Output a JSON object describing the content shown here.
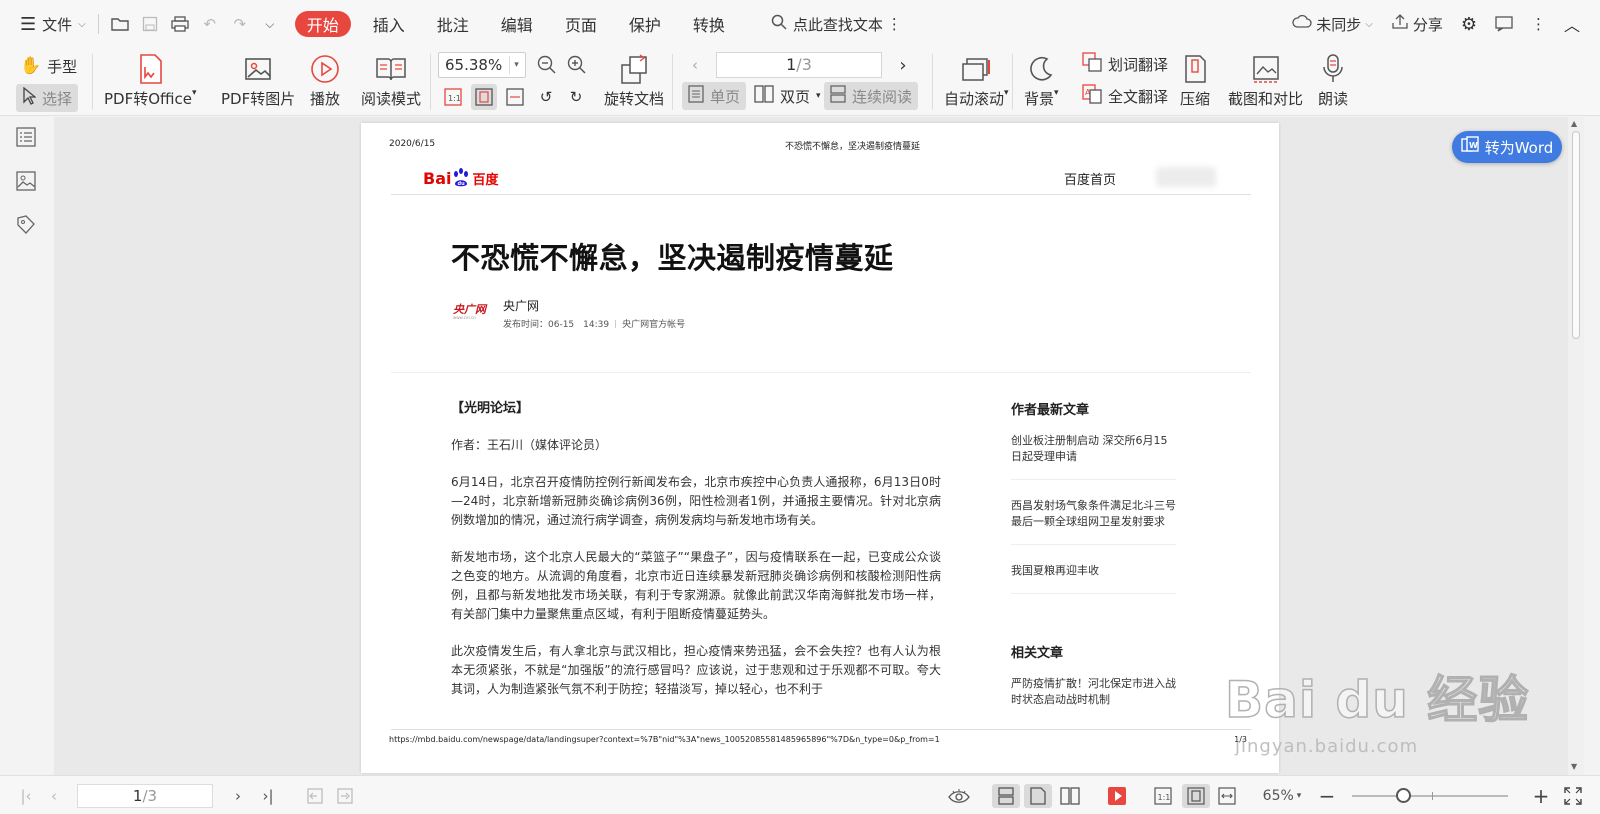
{
  "menubar": {
    "file_label": "文件",
    "tabs": [
      "开始",
      "插入",
      "批注",
      "编辑",
      "页面",
      "保护",
      "转换"
    ],
    "active_tab": "开始",
    "search_label": "点此查找文本",
    "sync_label": "未同步",
    "share_label": "分享"
  },
  "ribbon": {
    "hand_label": "手型",
    "select_label": "选择",
    "pdf_to_office": "PDF转Office",
    "pdf_to_image": "PDF转图片",
    "play": "播放",
    "reading_mode": "阅读模式",
    "zoom_value": "65.38%",
    "rotate_doc": "旋转文档",
    "page_current": "1",
    "page_total": "/3",
    "single_page": "单页",
    "double_page": "双页",
    "continuous": "连续阅读",
    "auto_scroll": "自动滚动",
    "background": "背景",
    "word_translate": "划词翻译",
    "full_translate": "全文翻译",
    "compress": "压缩",
    "screenshot_compare": "截图和对比",
    "read_aloud": "朗读"
  },
  "doc": {
    "date": "2020/6/15",
    "header_title": "不恐慌不懈怠，坚决遏制疫情蔓延",
    "logo_text_left": "Bai",
    "logo_text_right": "du",
    "logo_cn": "百度",
    "home_link": "百度首页",
    "title": "不恐慌不懈怠，坚决遏制疫情蔓延",
    "source_logo": "央广网",
    "source_logo_sub": "www.cnr.cn",
    "source_name": "央广网",
    "publish_time": "发布时间：06-15　14:39",
    "source_account": "央广网官方帐号",
    "section": "【光明论坛】",
    "author": "作者：王石川（媒体评论员）",
    "paragraphs": [
      "6月14日，北京召开疫情防控例行新闻发布会，北京市疾控中心负责人通报称，6月13日0时—24时，北京新增新冠肺炎确诊病例36例，阳性检测者1例，并通报主要情况。针对北京病例数增加的情况，通过流行病学调查，病例发病均与新发地市场有关。",
      "新发地市场，这个北京人民最大的“菜篮子”“果盘子”，因与疫情联系在一起，已变成公众谈之色变的地方。从流调的角度看，北京市近日连续暴发新冠肺炎确诊病例和核酸检测阳性病例，且都与新发地批发市场关联，有利于专家溯源。就像此前武汉华南海鲜批发市场一样，有关部门集中力量聚焦重点区域，有利于阻断疫情蔓延势头。",
      "此次疫情发生后，有人拿北京与武汉相比，担心疫情来势迅猛，会不会失控？也有人认为根本无须紧张，不就是“加强版”的流行感冒吗？应该说，过于悲观和过于乐观都不可取。夸大其词，人为制造紧张气氛不利于防控；轻描淡写，掉以轻心，也不利于"
    ],
    "aside_title": "作者最新文章",
    "aside_articles": [
      "创业板注册制启动 深交所6月15日起受理申请",
      "西昌发射场气象条件满足北斗三号最后一颗全球组网卫星发射要求",
      "我国夏粮再迎丰收"
    ],
    "related_title": "相关文章",
    "related_articles": [
      "严防疫情扩散！河北保定市进入战时状态启动战时机制"
    ],
    "footer_url": "https://mbd.baidu.com/newspage/data/landingsuper?context=%7B\"nid\"%3A\"news_10052085581485965896\"%7D&n_type=0&p_from=1",
    "footer_page": "1/3"
  },
  "convert_button": "转为Word",
  "watermark": {
    "logo": "Bai du 经验",
    "url": "jingyan.baidu.com"
  },
  "status": {
    "page_current": "1",
    "page_total": "/3",
    "zoom": "65%"
  },
  "colors": {
    "accent_red": "#e8473f",
    "word_blue": "#3f7be0",
    "baidu_red": "#e10601",
    "baidu_blue": "#2319dc"
  }
}
